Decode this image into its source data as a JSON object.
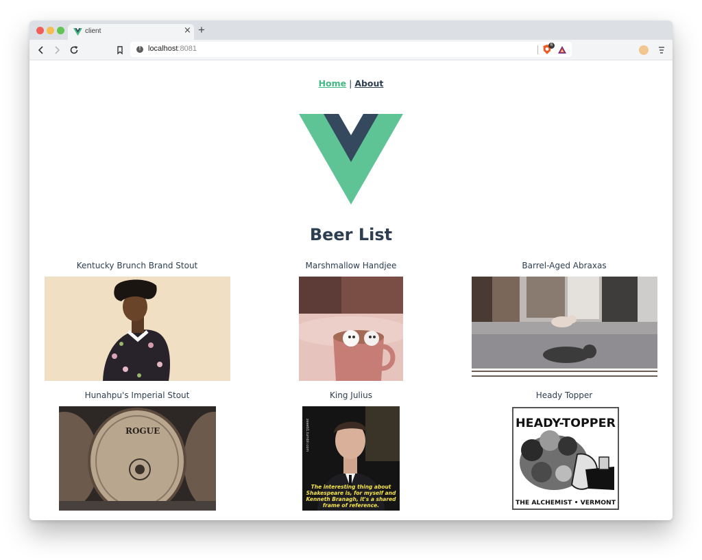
{
  "browser": {
    "tab_title": "client",
    "tab_close": "×",
    "new_tab": "+",
    "url_host": "localhost",
    "url_port": ":8081",
    "shield_badge_count": "6"
  },
  "nav": {
    "home": "Home",
    "separator": " | ",
    "about": "About"
  },
  "colors": {
    "vue_green": "#42b983",
    "vue_dark": "#35495e",
    "text": "#2c3e50"
  },
  "page": {
    "heading": "Beer List"
  },
  "beers": [
    {
      "name": "Kentucky Brunch Brand Stout",
      "image": "person-in-floral-jacket"
    },
    {
      "name": "Marshmallow Handjee",
      "image": "mug-of-cocoa-with-marshmallows"
    },
    {
      "name": "Barrel-Aged Abraxas",
      "image": "pigs-in-living-room"
    },
    {
      "name": "Hunahpu's Imperial Stout",
      "image": "rogue-barrel"
    },
    {
      "name": "King Julius",
      "image": "man-in-suit-with-caption"
    },
    {
      "name": "Heady Topper",
      "image": "heady-topper-logo"
    }
  ],
  "captions": {
    "rogue_label": "ROGUE",
    "king_julius_line1": "The interesting thing about",
    "king_julius_line2": "Shakespeare is, for myself and",
    "king_julius_line3": "Kenneth Branagh, it's a shared",
    "king_julius_line4": "frame of reference.",
    "king_julius_side": "zeeeb1.tumblr.com",
    "heady_top": "HEADY-TOPPER",
    "heady_bottom": "THE ALCHEMIST • VERMONT"
  }
}
